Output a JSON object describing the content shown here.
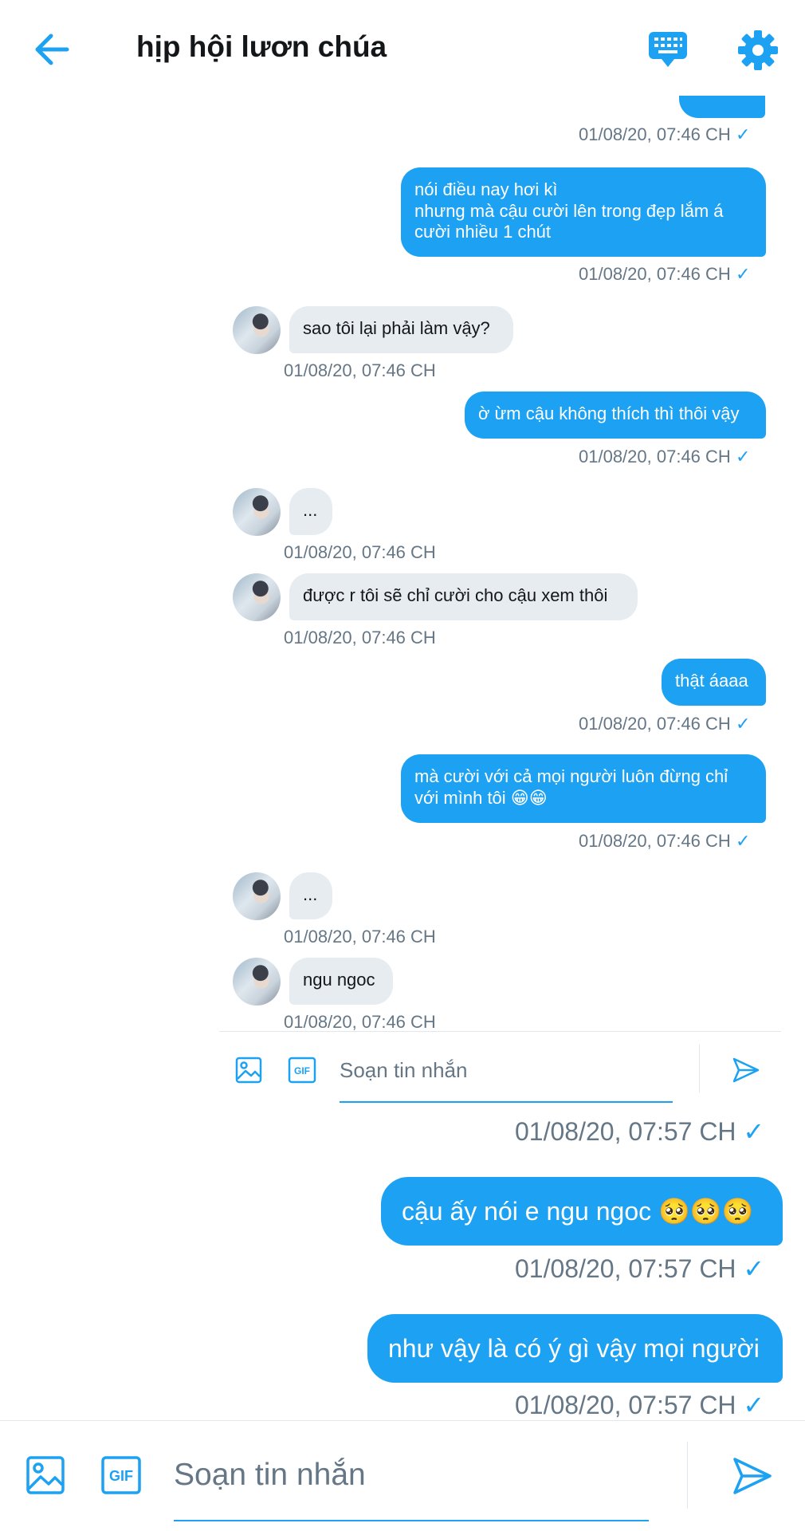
{
  "header": {
    "title": "hịp hội lươn chúa"
  },
  "inner_thread": {
    "top_timestamp": "01/08/20, 07:46 CH",
    "messages": [
      {
        "dir": "out",
        "text": "nói điều nay hơi kì\nnhưng mà cậu cười lên trong đẹp lắm á\ncười nhiều 1 chút",
        "time": "01/08/20, 07:46 CH"
      },
      {
        "dir": "in",
        "text": "sao tôi lại phải làm vậy?",
        "time": "01/08/20, 07:46 CH"
      },
      {
        "dir": "out",
        "text": "ờ ừm cậu không thích thì thôi vậy",
        "time": "01/08/20, 07:46 CH"
      },
      {
        "dir": "in",
        "text": "...",
        "time": "01/08/20, 07:46 CH"
      },
      {
        "dir": "in",
        "text": "được r tôi sẽ chỉ cười cho cậu xem thôi",
        "time": "01/08/20, 07:46 CH"
      },
      {
        "dir": "out",
        "text": "thật áaaa",
        "time": "01/08/20, 07:46 CH"
      },
      {
        "dir": "out",
        "text": "mà cười với cả mọi người luôn đừng chỉ\nvới mình tôi 😁😁",
        "time": "01/08/20, 07:46 CH"
      },
      {
        "dir": "in",
        "text": "...",
        "time": "01/08/20, 07:46 CH"
      },
      {
        "dir": "in",
        "text": "ngu ngoc",
        "time": "01/08/20, 07:46 CH"
      }
    ],
    "composer_placeholder": "Soạn tin nhắn",
    "gif_label": "GIF"
  },
  "thread": {
    "first_timestamp": "01/08/20, 07:57 CH",
    "messages": [
      {
        "dir": "out",
        "text": "cậu ấy nói e ngu ngoc 🥺🥺🥺",
        "time": "01/08/20, 07:57 CH"
      },
      {
        "dir": "out",
        "text": "như vậy là có ý gì vậy mọi người",
        "time": "01/08/20, 07:57 CH"
      }
    ]
  },
  "composer": {
    "placeholder": "Soạn tin nhắn",
    "gif_label": "GIF"
  },
  "check_glyph": "✓",
  "colors": {
    "accent": "#1da1f2",
    "incoming_bubble": "#e6ecf0",
    "muted": "#657786"
  }
}
